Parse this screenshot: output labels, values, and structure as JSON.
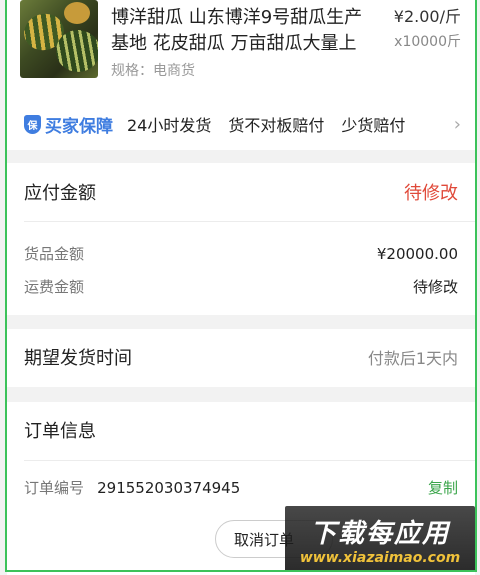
{
  "product": {
    "thumb_icon": "melon-photo",
    "name": "博洋甜瓜 山东博洋9号甜瓜生产基地 花皮甜瓜 万亩甜瓜大量上",
    "price": "¥2.00/斤",
    "quantity": "x10000斤",
    "spec_label": "规格：",
    "spec_value": "电商货"
  },
  "guarantee": {
    "title": "买家保障",
    "tags": [
      "24小时发货",
      "货不对板赔付",
      "少货赔付"
    ],
    "icon": "shield-icon",
    "chevron_icon": "chevron-right-icon"
  },
  "payment": {
    "title": "应付金额",
    "status": "待修改",
    "goods_label": "货品金额",
    "goods_value": "¥20000.00",
    "shipping_label": "运费金额",
    "shipping_value": "待修改"
  },
  "delivery": {
    "label": "期望发货时间",
    "value": "付款后1天内"
  },
  "order_info": {
    "title": "订单信息",
    "number_label": "订单编号",
    "number_value": "291552030374945",
    "copy_label": "复制",
    "cancel_label": "取消订单"
  },
  "watermark": {
    "main": "下载每应用",
    "sub": "www.xiazaimao.com"
  },
  "colors": {
    "accent_blue": "#3f7de0",
    "alert_red": "#e04a3a",
    "copy_green": "#3aa54a",
    "frame_green": "#3cc25a"
  }
}
